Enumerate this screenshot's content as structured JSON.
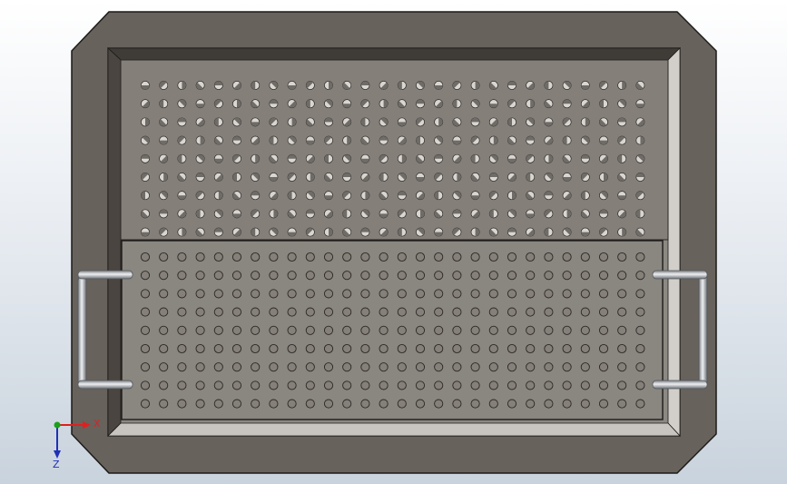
{
  "colors": {
    "background_top": "#ffffff",
    "background_bottom": "#c9d3dd",
    "tray_body": "#67625c",
    "tray_edge": "#1c1a18",
    "inner_floor": "#8c8882",
    "bevel_light": "#d2cfca",
    "bevel_dark": "#3f3b37",
    "upper_plate": "#847f79",
    "lower_plate": "#8a8680",
    "hole_fill": "#6f6b66",
    "hole_light": "#d9d6d1",
    "handle_light": "#eef0f2",
    "handle_dark": "#7d8186",
    "axis_x": "#e02020",
    "axis_y": "#1aa01a",
    "axis_z": "#1f2fb8"
  },
  "model": {
    "upper_perforated_plate": {
      "rows": 9,
      "columns": 28
    },
    "lower_perforated_plate": {
      "rows": 9,
      "columns": 28
    },
    "handles": [
      "left",
      "right"
    ]
  },
  "triad": {
    "x_label": "X",
    "z_label": "Z"
  }
}
